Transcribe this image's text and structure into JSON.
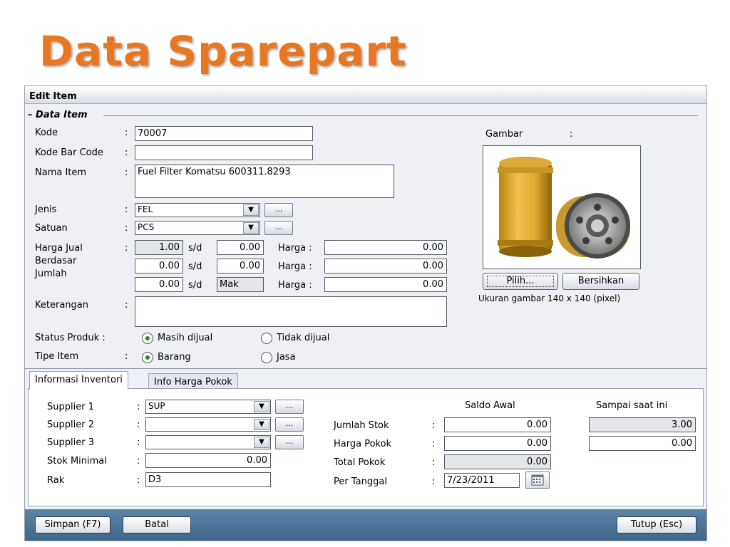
{
  "slide": {
    "title": "Data Sparepart"
  },
  "window": {
    "title": "Edit Item",
    "group_title": "Data Item"
  },
  "form": {
    "colon": ":",
    "kode": {
      "label": "Kode",
      "value": "70007"
    },
    "barcode": {
      "label": "Kode Bar Code",
      "value": ""
    },
    "nama": {
      "label": "Nama Item",
      "value": "Fuel Filter Komatsu 600311.8293"
    },
    "jenis": {
      "label": "Jenis",
      "value": "FEL"
    },
    "satuan": {
      "label": "Satuan",
      "value": "PCS"
    },
    "harga_jual_label": "Harga Jual",
    "berdasar_label": "Berdasar",
    "jumlah_label": "Jumlah",
    "sd": "s/d",
    "harga_label": "Harga :",
    "price_rows": [
      {
        "from": "1.00",
        "to": "0.00",
        "price": "0.00"
      },
      {
        "from": "0.00",
        "to": "0.00",
        "price": "0.00"
      },
      {
        "from": "0.00",
        "to": "Mak",
        "price": "0.00"
      }
    ],
    "keterangan": {
      "label": "Keterangan",
      "value": ""
    },
    "status": {
      "label": "Status Produk :",
      "opt1": "Masih dijual",
      "opt2": "Tidak dijual",
      "selected": "Masih dijual"
    },
    "tipe": {
      "label": "Tipe Item",
      "opt1": "Barang",
      "opt2": "Jasa",
      "selected": "Barang"
    },
    "ellipsis": "..."
  },
  "image": {
    "label": "Gambar",
    "colon": ":",
    "choose_button": "Pilih...",
    "clear_button": "Bersihkan",
    "size_note": "Ukuran gambar 140 x 140 (pixel)"
  },
  "tabs": [
    {
      "label": "Informasi Inventori",
      "active": true
    },
    {
      "label": "Info Harga Pokok",
      "active": false
    }
  ],
  "inventory": {
    "supplier1": {
      "label": "Supplier 1",
      "value": "SUP"
    },
    "supplier2": {
      "label": "Supplier 2",
      "value": ""
    },
    "supplier3": {
      "label": "Supplier 3",
      "value": ""
    },
    "stok_minimal": {
      "label": "Stok Minimal",
      "value": "0.00"
    },
    "rak": {
      "label": "Rak",
      "value": "D3"
    },
    "saldo_awal_header": "Saldo Awal",
    "sampai_header": "Sampai saat ini",
    "jumlah_stok": {
      "label": "Jumlah Stok",
      "saldo": "0.00",
      "sampai": "3.00"
    },
    "harga_pokok": {
      "label": "Harga Pokok",
      "saldo": "0.00",
      "sampai": "0.00"
    },
    "total_pokok": {
      "label": "Total Pokok",
      "saldo": "0.00"
    },
    "per_tanggal": {
      "label": "Per Tanggal",
      "value": "7/23/2011"
    }
  },
  "footer": {
    "save": "Simpan (F7)",
    "cancel": "Batal",
    "close": "Tutup (Esc)"
  },
  "colors": {
    "title_orange": "#e87722",
    "footer_blue": "#4a7396"
  }
}
